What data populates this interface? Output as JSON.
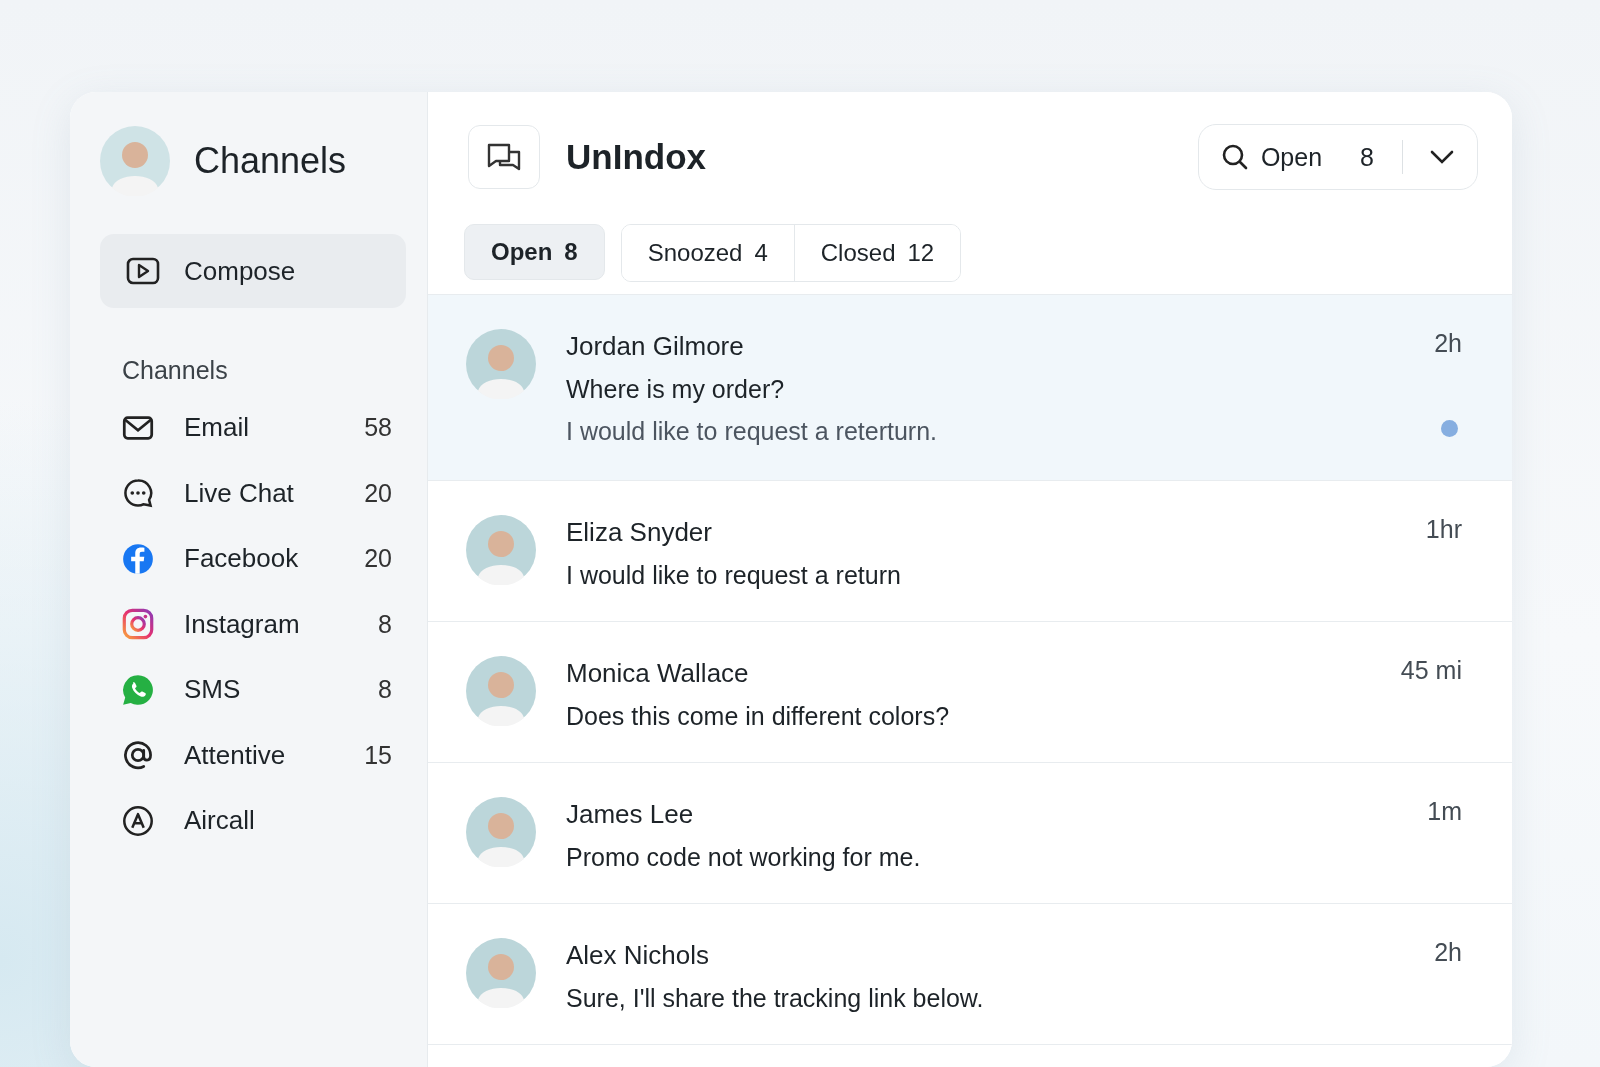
{
  "sidebar": {
    "title": "Channels",
    "compose": "Compose",
    "section": "Channels",
    "items": [
      {
        "label": "Email",
        "count": "58"
      },
      {
        "label": "Live Chat",
        "count": "20"
      },
      {
        "label": "Facebook",
        "count": "20"
      },
      {
        "label": "Instagram",
        "count": "8"
      },
      {
        "label": "SMS",
        "count": "8"
      },
      {
        "label": "Attentive",
        "count": "15"
      },
      {
        "label": "Aircall"
      }
    ]
  },
  "header": {
    "title": "UnIndox",
    "filter": {
      "label": "Open",
      "count": "8"
    }
  },
  "tabs": [
    {
      "label": "Open",
      "count": "8",
      "selected": true
    },
    {
      "label": "Snoozed",
      "count": "4",
      "selected": false
    },
    {
      "label": "Closed",
      "count": "12",
      "selected": false
    }
  ],
  "conversations": [
    {
      "name": "Jordan Gilmore",
      "time": "2h",
      "selected": true,
      "unread": true,
      "lines": [
        {
          "kind": "subject",
          "text": "Where is my order?"
        },
        {
          "kind": "preview",
          "text": "I would like to request a reterturn."
        }
      ]
    },
    {
      "name": "Eliza Snyder",
      "time": "1hr",
      "selected": false,
      "unread": false,
      "lines": [
        {
          "kind": "message",
          "text": "I would like to request a return"
        }
      ]
    },
    {
      "name": "Monica Wallace",
      "time": "45 mi",
      "selected": false,
      "unread": false,
      "lines": [
        {
          "kind": "message",
          "text": "Does this come in different colors?"
        }
      ]
    },
    {
      "name": "James Lee",
      "time": "1m",
      "selected": false,
      "unread": false,
      "lines": [
        {
          "kind": "message",
          "text": "Promo code not working for me."
        }
      ]
    },
    {
      "name": "Alex Nichols",
      "time": "2h",
      "selected": false,
      "unread": false,
      "lines": [
        {
          "kind": "message",
          "text": "Sure, I'll share the tracking link below."
        }
      ]
    }
  ]
}
